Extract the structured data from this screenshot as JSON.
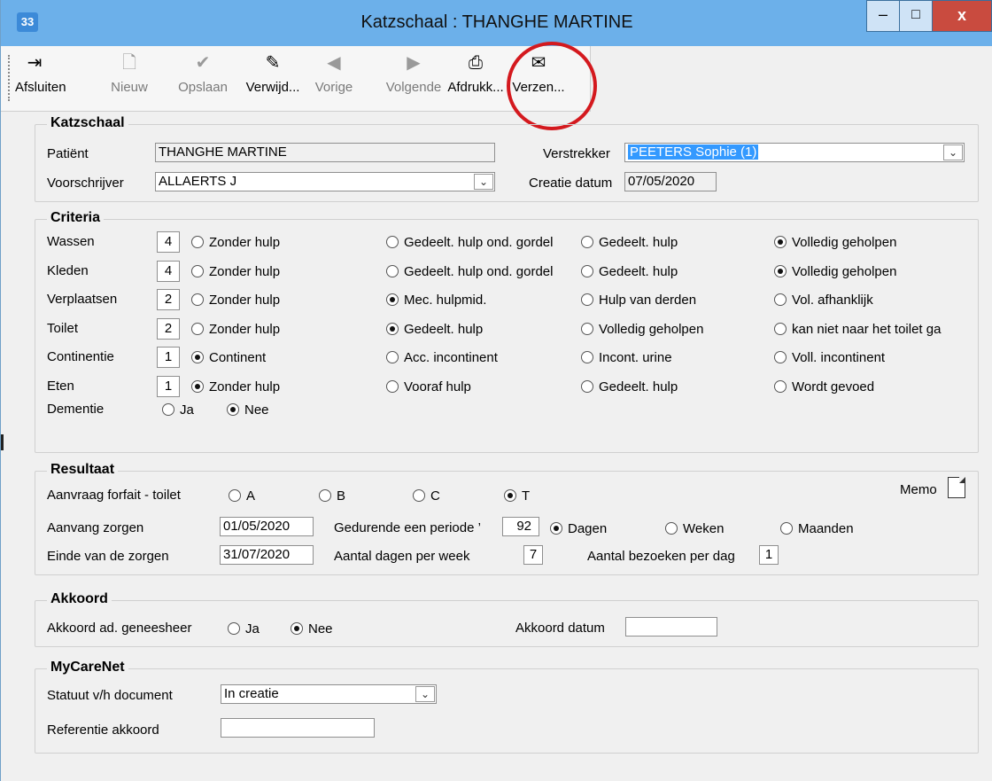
{
  "window": {
    "title": "Katzschaal : THANGHE MARTINE",
    "app_icon": "33",
    "minimize": "–",
    "maximize": "□",
    "close": "x"
  },
  "toolbar": [
    {
      "key": "afsluiten",
      "label": "Afsluiten",
      "icon": "exit-door-icon",
      "glyph": "⇥",
      "enabled": true
    },
    {
      "key": "nieuw",
      "label": "Nieuw",
      "icon": "new-document-icon",
      "glyph": "🗋",
      "enabled": false
    },
    {
      "key": "opslaan",
      "label": "Opslaan",
      "icon": "checkmark-icon",
      "glyph": "✔",
      "enabled": false
    },
    {
      "key": "verwijderen",
      "label": "Verwijd...",
      "icon": "eraser-icon",
      "glyph": "✎",
      "enabled": true
    },
    {
      "key": "vorige",
      "label": "Vorige",
      "icon": "arrow-left-icon",
      "glyph": "◀",
      "enabled": false
    },
    {
      "key": "volgende",
      "label": "Volgende",
      "icon": "arrow-right-icon",
      "glyph": "▶",
      "enabled": false
    },
    {
      "key": "afdrukken",
      "label": "Afdrukk...",
      "icon": "printer-icon",
      "glyph": "⎙",
      "enabled": true
    },
    {
      "key": "verzenden",
      "label": "Verzen...",
      "icon": "send-icon",
      "glyph": "✉",
      "enabled": true
    }
  ],
  "katzschaal": {
    "title": "Katzschaal",
    "patient_label": "Patiënt",
    "patient_value": "THANGHE MARTINE",
    "voorschrijver_label": "Voorschrijver",
    "voorschrijver_value": "ALLAERTS J",
    "verstrekker_label": "Verstrekker",
    "verstrekker_value": "PEETERS Sophie (1)",
    "creatie_label": "Creatie datum",
    "creatie_value": "07/05/2020",
    "dropdown_glyph": "⌄"
  },
  "criteria": {
    "title": "Criteria",
    "rows": [
      {
        "label": "Wassen",
        "score": "4",
        "options": [
          "Zonder hulp",
          "Gedeelt. hulp ond. gordel",
          "Gedeelt. hulp",
          "Volledig geholpen"
        ],
        "selected": 3
      },
      {
        "label": "Kleden",
        "score": "4",
        "options": [
          "Zonder hulp",
          "Gedeelt. hulp ond. gordel",
          "Gedeelt. hulp",
          "Volledig geholpen"
        ],
        "selected": 3
      },
      {
        "label": "Verplaatsen",
        "score": "2",
        "options": [
          "Zonder hulp",
          "Mec. hulpmid.",
          "Hulp van derden",
          "Vol. afhanklijk"
        ],
        "selected": 1
      },
      {
        "label": "Toilet",
        "score": "2",
        "options": [
          "Zonder hulp",
          "Gedeelt. hulp",
          "Volledig geholpen",
          "kan niet naar het toilet ga"
        ],
        "selected": 1
      },
      {
        "label": "Continentie",
        "score": "1",
        "options": [
          "Continent",
          "Acc. incontinent",
          "Incont. urine",
          "Voll. incontinent"
        ],
        "selected": 0
      },
      {
        "label": "Eten",
        "score": "1",
        "options": [
          "Zonder hulp",
          "Vooraf hulp",
          "Gedeelt. hulp",
          "Wordt gevoed"
        ],
        "selected": 0
      }
    ],
    "dementie_label": "Dementie",
    "dementie_options": [
      "Ja",
      "Nee"
    ],
    "dementie_selected": 1
  },
  "resultaat": {
    "title": "Resultaat",
    "forfait_label": "Aanvraag forfait - toilet",
    "forfait_options": [
      "A",
      "B",
      "C",
      "T"
    ],
    "forfait_selected": 3,
    "memo_label": "Memo",
    "aanvang_label": "Aanvang zorgen",
    "aanvang_value": "01/05/2020",
    "periode_label": "Gedurende een periode ’",
    "periode_value": "92",
    "periode_options": [
      "Dagen",
      "Weken",
      "Maanden"
    ],
    "periode_selected": 0,
    "einde_label": "Einde van de zorgen",
    "einde_value": "31/07/2020",
    "dagen_label": "Aantal dagen per week",
    "dagen_value": "7",
    "bezoeken_label": "Aantal bezoeken per dag",
    "bezoeken_value": "1"
  },
  "akkoord": {
    "title": "Akkoord",
    "geneesheer_label": "Akkoord ad. geneesheer",
    "geneesheer_options": [
      "Ja",
      "Nee"
    ],
    "geneesheer_selected": 1,
    "datum_label": "Akkoord datum",
    "datum_value": ""
  },
  "mycarenet": {
    "title": "MyCareNet",
    "statuut_label": "Statuut v/h document",
    "statuut_value": "In creatie",
    "referentie_label": "Referentie akkoord",
    "referentie_value": ""
  },
  "colors": {
    "titlebar": "#6cb0ea",
    "selection": "#3399ff",
    "highlight_circle": "#d4191e",
    "close_button": "#c94b3f"
  }
}
